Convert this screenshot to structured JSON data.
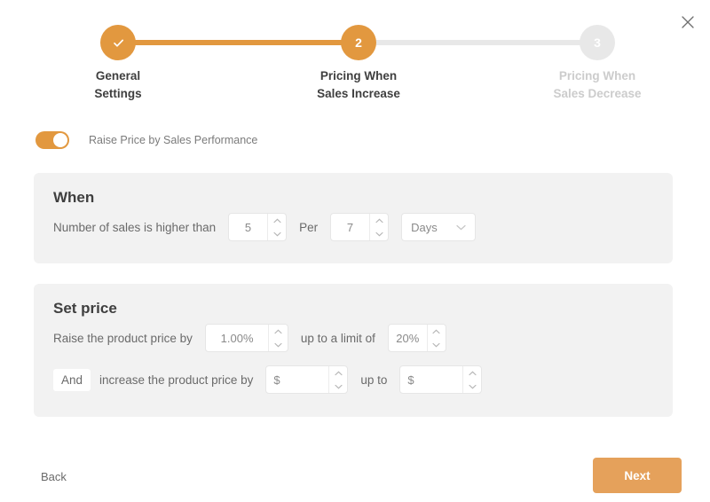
{
  "dialog": {
    "close_icon": "close-icon"
  },
  "stepper": {
    "steps": [
      {
        "number": "1",
        "indicator": "check-icon",
        "state": "completed",
        "label_line1": "General",
        "label_line2": "Settings"
      },
      {
        "number": "2",
        "indicator": "2",
        "state": "active",
        "label_line1": "Pricing When",
        "label_line2": "Sales Increase"
      },
      {
        "number": "3",
        "indicator": "3",
        "state": "upcoming",
        "label_line1": "Pricing When",
        "label_line2": "Sales Decrease"
      }
    ]
  },
  "toggle": {
    "label": "Raise Price by Sales Performance",
    "state": "on"
  },
  "when_panel": {
    "title": "When",
    "text_before": "Number of sales is higher than",
    "sales_count_value": "5",
    "text_per": "Per",
    "period_value": "7",
    "period_unit": "Days",
    "period_unit_icon": "chevron-down-icon"
  },
  "set_price_panel": {
    "title": "Set price",
    "row1": {
      "text_before": "Raise the product price by",
      "percent_value": "1.00%",
      "text_middle": "up to a limit of",
      "limit_value": "20%"
    },
    "row2": {
      "conjunction": "And",
      "text_before": "increase the product price by",
      "amount_placeholder": "$",
      "text_middle": "up to",
      "limit_placeholder": "$"
    }
  },
  "footer": {
    "back_label": "Back",
    "next_label": "Next"
  },
  "colors": {
    "accent": "#e2983f",
    "next_button": "#e5a15b",
    "inactive": "#e8e8e8",
    "panel_bg": "#f2f2f2"
  }
}
